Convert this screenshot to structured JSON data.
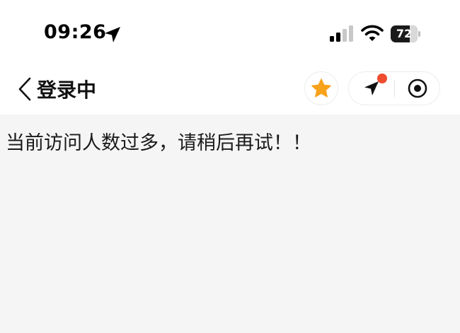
{
  "status_bar": {
    "time": "09:26",
    "battery_level": "72",
    "battery_percent": 72,
    "icons": [
      "location-arrow-icon",
      "cellular-signal-icon",
      "wifi-icon",
      "battery-icon"
    ]
  },
  "nav": {
    "back_icon": "chevron-left-icon",
    "title": "登录中",
    "favorite_icon": "star-icon",
    "capsule_icons": [
      "location-arrow-icon",
      "target-icon"
    ]
  },
  "content": {
    "message": "当前访问人数过多，请稍后再试！！"
  },
  "colors": {
    "star": "#f7a21b",
    "notification_dot": "#f04c2f",
    "page_background": "#f5f5f5",
    "header_background": "#ffffff"
  }
}
